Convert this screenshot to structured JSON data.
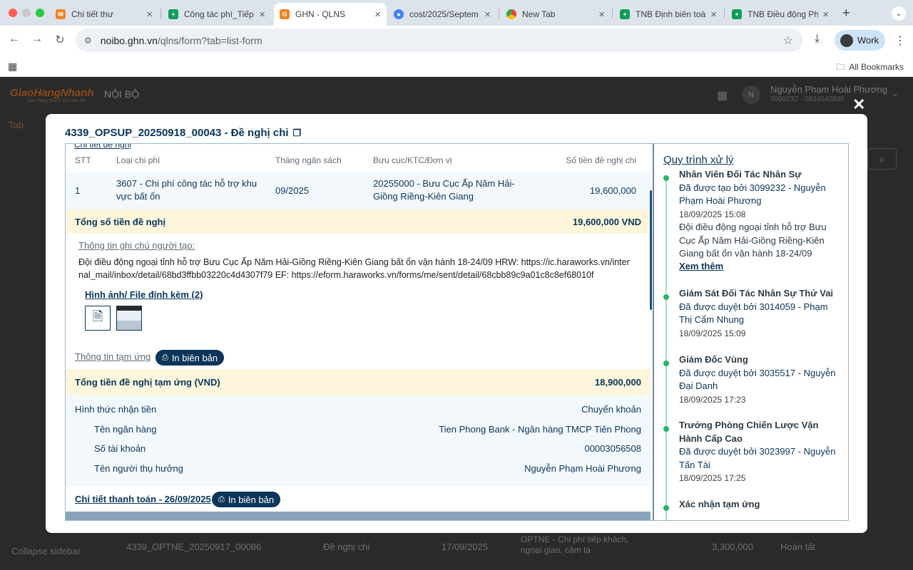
{
  "browser": {
    "tabs": [
      {
        "title": "Chi tiết thư",
        "icon": "orange-app-icon"
      },
      {
        "title": "Công tác phí_Tiếp",
        "icon": "sheets-icon"
      },
      {
        "title": "GHN - QLNS",
        "icon": "ghn-icon",
        "active": true
      },
      {
        "title": "cost/2025/Septem",
        "icon": "drive-icon"
      },
      {
        "title": "New Tab",
        "icon": "chrome-icon"
      },
      {
        "title": "TNB Định biên toàn",
        "icon": "sheets-icon"
      },
      {
        "title": "TNB Điều động Phư",
        "icon": "sheets-icon"
      }
    ],
    "url_host": "noibo.ghn.vn",
    "url_path": "/qlns/form?tab=list-form",
    "profile_label": "Work",
    "bookmarks_label": "All Bookmarks"
  },
  "background_app": {
    "logo": "GiaoHangNhanh",
    "logo_sub": "Giao Hàng Nhanh Giá Siêu Rẻ",
    "section": "NỘI BỘ",
    "avatar_letter": "N",
    "user_name": "Nguyễn Phạm Hoài Phương",
    "user_id": "3099232 - 0834540836",
    "tab": "Tab",
    "collapse": "Collapse sidebar",
    "row": {
      "code": "4339_OPTNE_20250917_00086",
      "type": "Đề nghị chi",
      "date": "17/09/2025",
      "desc": "OPTNE - Chi phí tiếp khách, ngoại giao, cảm tạ",
      "amount": "3,300,000",
      "status": "Hoàn tất"
    }
  },
  "modal": {
    "title": "4339_OPSUP_20250918_00043 - Đề nghị chi",
    "cut_text": "Chi tiết đề nghị",
    "table": {
      "headers": {
        "stt": "STT",
        "type": "Loại chi phí",
        "month": "Tháng ngân sách",
        "unit": "Bưu cục/KTC/Đơn vị",
        "amount": "Số tiền đề nghị chi"
      },
      "rows": [
        {
          "stt": "1",
          "type": "3607 - Chi phí công tác hỗ trợ khu vực bất ổn",
          "month": "09/2025",
          "unit": "20255000 - Bưu Cục Ấp Năm Hải-Giồng Riềng-Kiên Giang",
          "amount": "19,600,000"
        }
      ],
      "total_label": "Tổng số tiền đề nghị",
      "total_value": "19,600,000 VND"
    },
    "note": {
      "title": "Thông tin ghi chú người tạo:",
      "text": "Đội điều động ngoại tỉnh hỗ trợ Bưu Cục Ấp Năm Hải-Giồng Riềng-Kiên Giang bất ổn vận hành 18-24/09 HRW: https://ic.haraworks.vn/internal_mail/inbox/detail/68bd3ffbb03220c4d4307f79 EF: https://eform.haraworks.vn/forms/me/sent/detail/68cbb89c9a01c8c8ef68010f"
    },
    "attachments": {
      "title": "Hình ảnh/ File đính kèm (2)"
    },
    "advance": {
      "title": "Thông tin tạm ứng",
      "print_label": "In biên bản",
      "total_label": "Tổng tiền đề nghị tạm ứng (VND)",
      "total_value": "18,900,000",
      "method_label": "Hình thức nhận tiền",
      "method_value": "Chuyển khoản",
      "bank_label": "Tên ngân hàng",
      "bank_value": "Tien Phong Bank - Ngân hàng TMCP Tiên Phong",
      "account_label": "Số tài khoản",
      "account_value": "00003056508",
      "beneficiary_label": "Tên người thụ hưởng",
      "beneficiary_value": "Nguyễn Phạm Hoài Phương"
    },
    "payment": {
      "title": "Chi tiết thanh toán - 26/09/2025",
      "print_label": "In biên bản"
    },
    "process": {
      "title": "Quy trình xử lý",
      "steps": [
        {
          "role": "Nhân Viên Đối Tác Nhân Sự",
          "by": "Đã được tạo bởi 3099232 - Nguyễn Phạm Hoài Phương",
          "time": "18/09/2025 15:08",
          "desc": "Đội điều động ngoại tỉnh hỗ trợ Bưu Cục Ấp Năm Hải-Giồng Riềng-Kiên Giang bất ổn vận hành 18-24/09 HRW...",
          "more": "Xem thêm"
        },
        {
          "role": "Giám Sát Đối Tác Nhân Sự Thử Vai",
          "by": "Đã được duyệt bởi 3014059 - Phạm Thị Cẩm Nhung",
          "time": "18/09/2025 15:09"
        },
        {
          "role": "Giám Đốc Vùng",
          "by": "Đã được duyệt bởi 3035517 - Nguyễn Đại Danh",
          "time": "18/09/2025 17:23"
        },
        {
          "role": "Trưởng Phòng Chiến Lược Vận Hành Cấp Cao",
          "by": "Đã được duyệt bởi 3023997 - Nguyễn Tấn Tài",
          "time": "18/09/2025 17:25"
        },
        {
          "role": "Xác nhận tạm ứng"
        }
      ]
    }
  }
}
